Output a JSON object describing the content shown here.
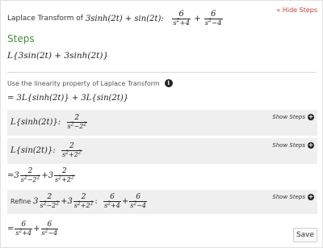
{
  "header": {
    "label": "Laplace Transform of",
    "expr_left": "3sinh(2t) + sin(2t):",
    "ans_num1": "6",
    "ans_num2": "6",
    "hide_steps": "« Hide Steps"
  },
  "steps": {
    "title": "Steps",
    "start_expr": "L{3sin(2t) + 3sinh(2t)}",
    "linearity_text": "Use the linearity property of Laplace Transform",
    "info_glyph": "i",
    "linear_result": "= 3L{sinh(2t)} + 3L{sin(2t)}"
  },
  "rows": {
    "sinh": {
      "lhs": "L{sinh(2t)}:",
      "num": "2",
      "show": "Show Steps"
    },
    "sin": {
      "lhs": "L{sin(2t)}:",
      "num": "2",
      "show": "Show Steps"
    },
    "refine": {
      "label": "Refine",
      "show": "Show Steps"
    }
  },
  "combined": {
    "coef": "3",
    "num": "2"
  },
  "final": {
    "num1": "6",
    "num2": "6"
  },
  "save_button": "Save",
  "colors": {
    "accent": "#c8413b",
    "steps_title": "#4a8e3d",
    "row_bg": "#efefef"
  }
}
